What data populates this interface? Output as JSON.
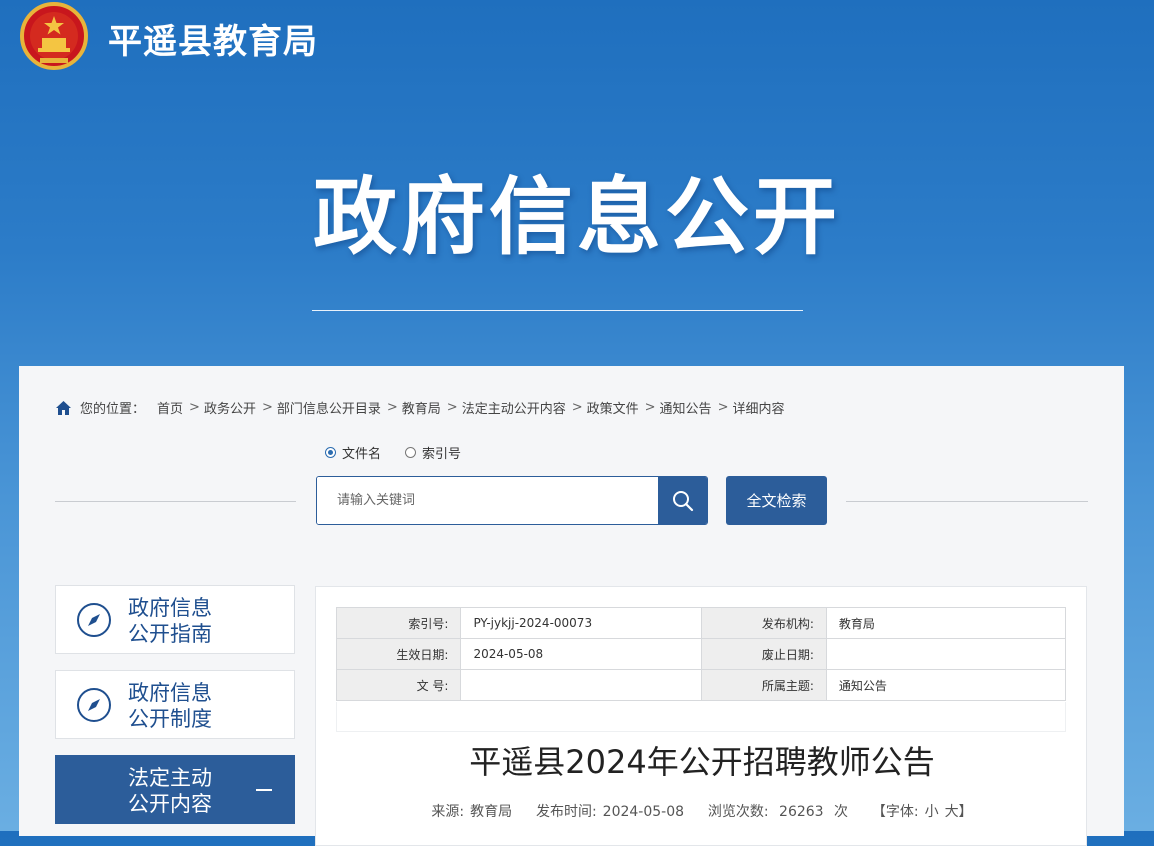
{
  "header": {
    "site_title": "平遥县教育局",
    "banner_title": "政府信息公开",
    "emblem_icon": "national-emblem-icon"
  },
  "breadcrumb": {
    "prefix": "您的位置：",
    "items": [
      "首页",
      "政务公开",
      "部门信息公开目录",
      "教育局",
      "法定主动公开内容",
      "政策文件",
      "通知公告",
      "详细内容"
    ],
    "separator": ">"
  },
  "search": {
    "radio_options": [
      {
        "label": "文件名",
        "selected": true
      },
      {
        "label": "索引号",
        "selected": false
      }
    ],
    "placeholder": "请输入关键词",
    "fulltext_label": "全文检索"
  },
  "sidebar": {
    "items": [
      {
        "line1": "政府信息",
        "line2": "公开指南",
        "active": false
      },
      {
        "line1": "政府信息",
        "line2": "公开制度",
        "active": false
      },
      {
        "line1": "法定主动",
        "line2": "公开内容",
        "active": true
      }
    ]
  },
  "meta": {
    "index_label": "索引号:",
    "index_value": "PY-jykjj-2024-00073",
    "publisher_label": "发布机构:",
    "publisher_value": "教育局",
    "effective_label": "生效日期:",
    "effective_value": "2024-05-08",
    "expiry_label": "废止日期:",
    "expiry_value": "",
    "docno_label": "文 号:",
    "docno_value": "",
    "topic_label": "所属主题:",
    "topic_value": "通知公告"
  },
  "article": {
    "title": "平遥县2024年公开招聘教师公告",
    "source_label": "来源:",
    "source_value": "教育局",
    "date_label": "发布时间:",
    "date_value": "2024-05-08",
    "views_label": "浏览次数:",
    "views_value": "26263",
    "views_unit": "次",
    "font_label": "【字体:",
    "font_small": "小",
    "font_large": "大】"
  },
  "colors": {
    "primary": "#2c5d9a",
    "banner_top": "#1f6fbe",
    "banner_bottom": "#6aaee2"
  }
}
